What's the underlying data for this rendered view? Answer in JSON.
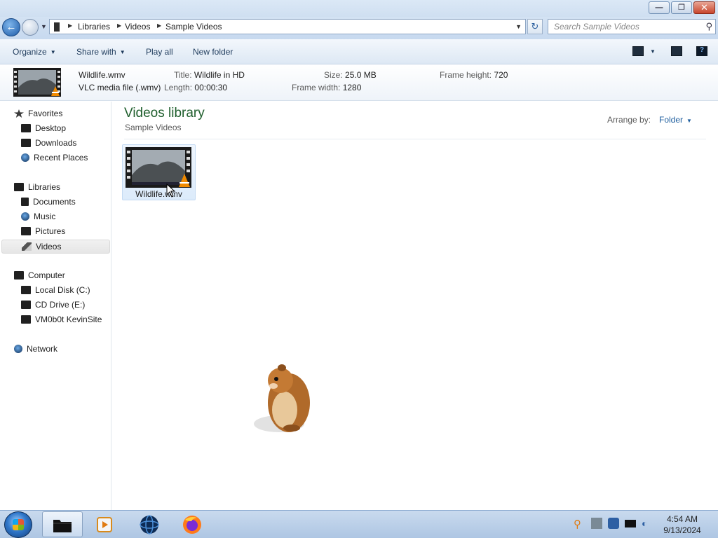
{
  "window": {
    "minimize_glyph": "—",
    "maximize_glyph": "❐",
    "close_glyph": "✕"
  },
  "address_bar": {
    "breadcrumbs": [
      "Libraries",
      "Videos",
      "Sample Videos"
    ],
    "search_placeholder": "Search Sample Videos"
  },
  "toolbar": {
    "organize": "Organize",
    "share_with": "Share with",
    "play_all": "Play all",
    "new_folder": "New folder"
  },
  "details": {
    "file_name": "Wildlife.wmv",
    "file_type": "VLC media file (.wmv)",
    "title_label": "Title:",
    "title_value": "Wildlife in HD",
    "length_label": "Length:",
    "length_value": "00:00:30",
    "size_label": "Size:",
    "size_value": "25.0 MB",
    "frame_width_label": "Frame width:",
    "frame_width_value": "1280",
    "frame_height_label": "Frame height:",
    "frame_height_value": "720"
  },
  "nav": {
    "favorites": "Favorites",
    "desktop": "Desktop",
    "downloads": "Downloads",
    "recent_places": "Recent Places",
    "libraries": "Libraries",
    "documents": "Documents",
    "music": "Music",
    "pictures": "Pictures",
    "videos": "Videos",
    "computer": "Computer",
    "local_disk": "Local Disk (C:)",
    "cd_drive": "CD Drive (E:)",
    "network_share": "VM0b0t KevinSite",
    "network": "Network"
  },
  "main": {
    "library_title": "Videos library",
    "library_subtitle": "Sample Videos",
    "arrange_label": "Arrange by:",
    "arrange_value": "Folder",
    "files": [
      {
        "name": "Wildlife.wmv",
        "icon": "video-thumbnail-icon"
      }
    ]
  },
  "taskbar": {
    "time": "4:54 AM",
    "date": "9/13/2024",
    "pinned": [
      "windows-explorer-icon",
      "media-player-icon",
      "network-globe-icon",
      "firefox-icon"
    ],
    "tray": [
      "search-tray-icon",
      "tools-tray-icon",
      "shield-tray-icon",
      "display-tray-icon",
      "volume-tray-icon"
    ]
  },
  "colors": {
    "library_title": "#1e5e2c",
    "selection": "#dcebfb",
    "taskbar": "#b7cde8"
  }
}
